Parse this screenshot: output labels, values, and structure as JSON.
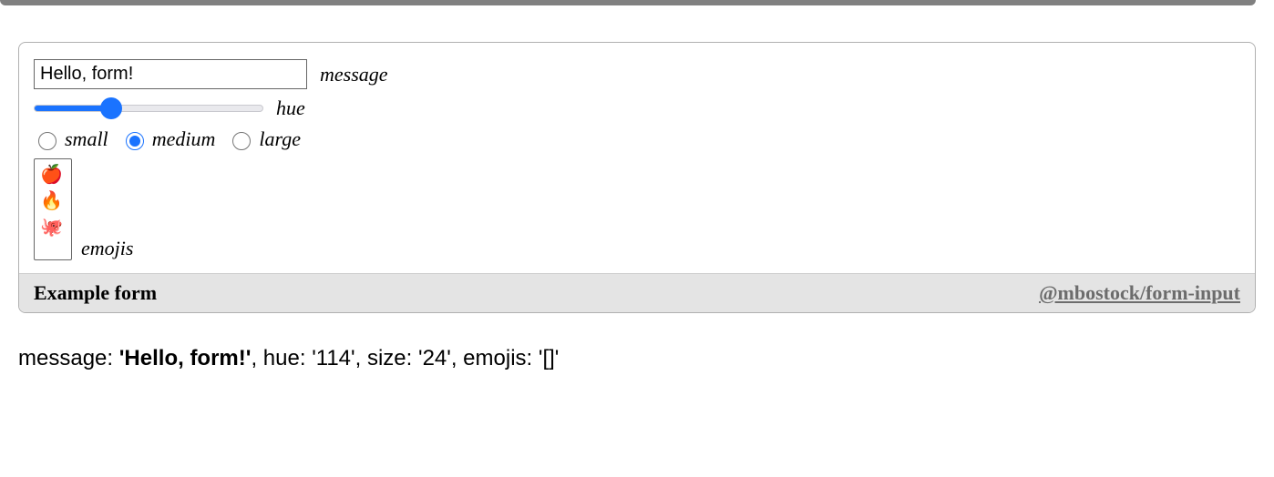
{
  "form": {
    "message": {
      "label": "message",
      "value": "Hello, form!"
    },
    "hue": {
      "label": "hue",
      "value": 114,
      "min": 0,
      "max": 360
    },
    "size": {
      "label_small": "small",
      "label_medium": "medium",
      "label_large": "large",
      "selected": "medium"
    },
    "emojis": {
      "label": "emojis",
      "options": [
        "🍎",
        "🔥",
        "🐙"
      ]
    }
  },
  "footer": {
    "title": "Example form",
    "link": "@mbostock/form-input"
  },
  "output": {
    "message_key": "message: ",
    "message_val": "'Hello, form!'",
    "hue_key": ", hue: ",
    "hue_val": "'114'",
    "size_key": ", size: ",
    "size_val": "'24'",
    "emojis_key": ", emojis: ",
    "emojis_val": "'[]'"
  }
}
